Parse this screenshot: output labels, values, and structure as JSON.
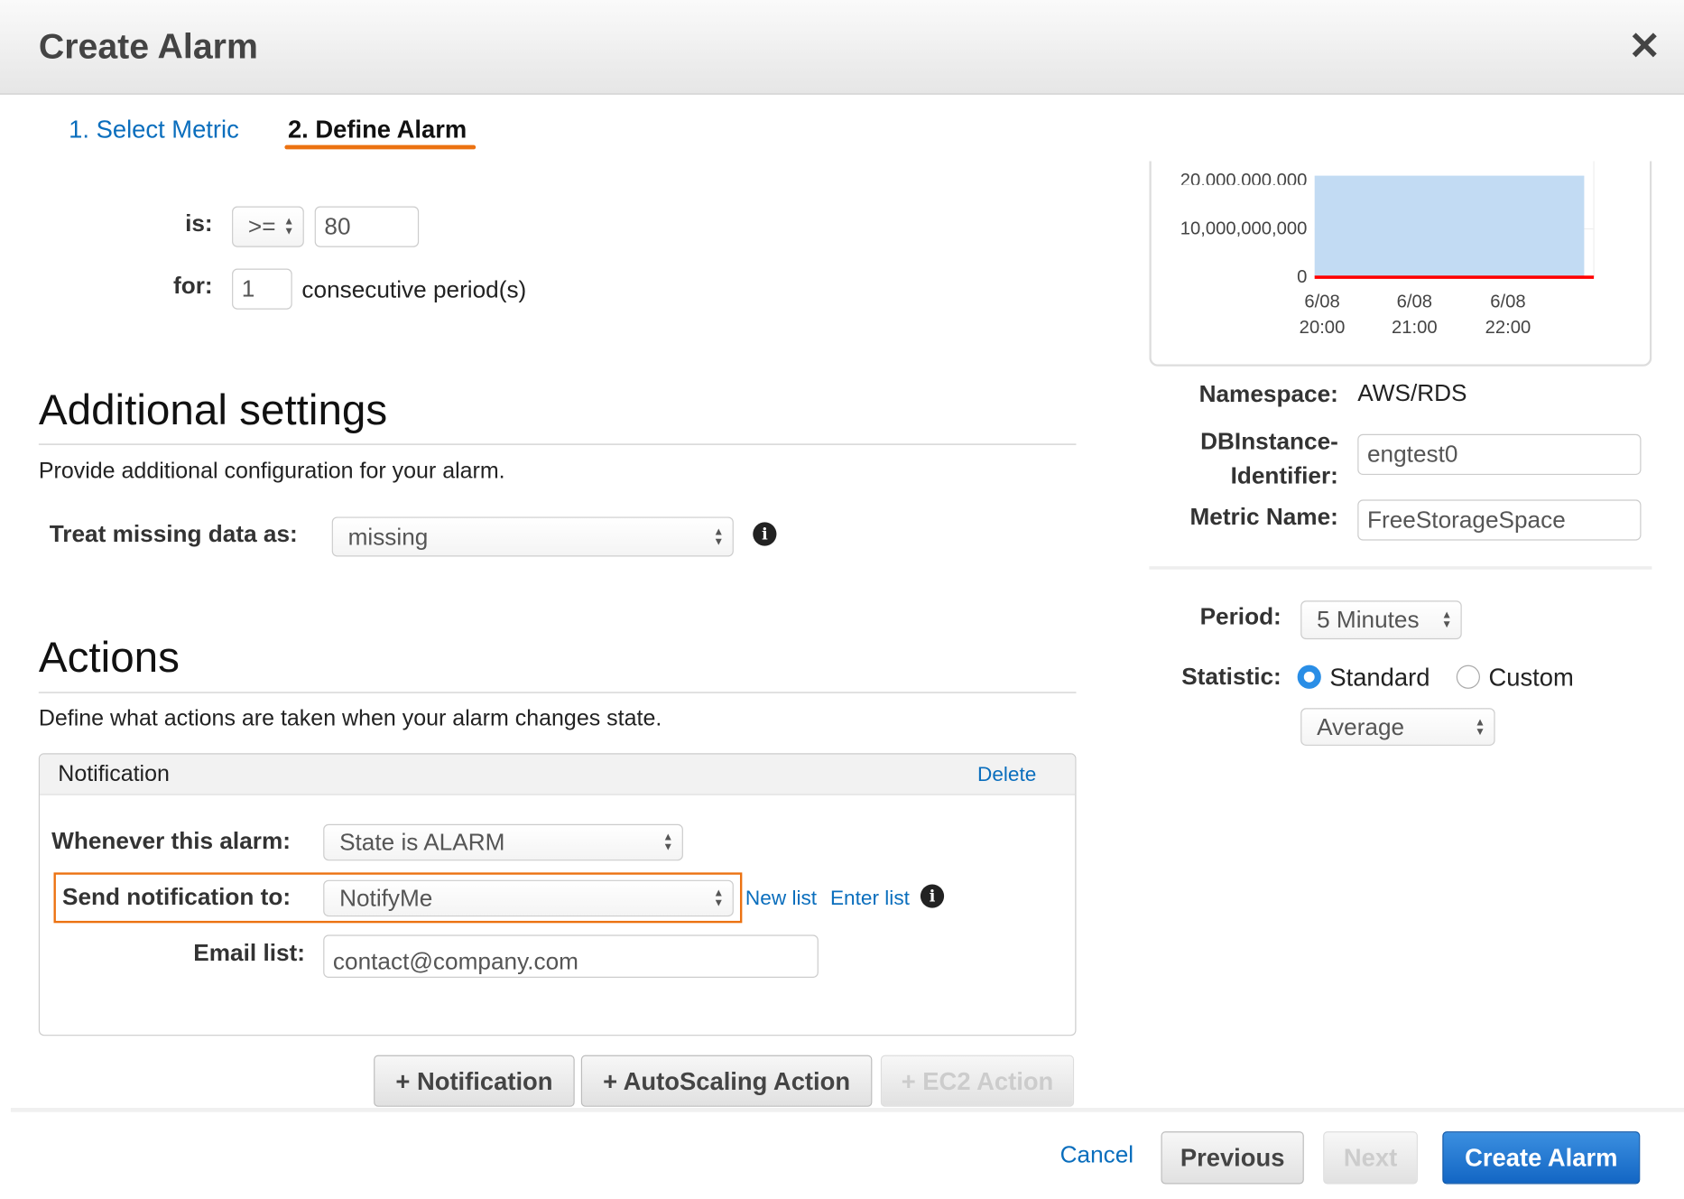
{
  "dialog": {
    "title": "Create Alarm",
    "close_icon": "close-icon"
  },
  "tabs": [
    {
      "label": "1. Select Metric",
      "active": false
    },
    {
      "label": "2. Define Alarm",
      "active": true
    }
  ],
  "threshold": {
    "is_label": "is:",
    "operator": ">=",
    "value": "80",
    "for_label": "for:",
    "periods": "1",
    "periods_suffix": "consecutive period(s)"
  },
  "additional": {
    "heading": "Additional settings",
    "description": "Provide additional configuration for your alarm.",
    "treat_label": "Treat missing data as:",
    "treat_value": "missing"
  },
  "actions": {
    "heading": "Actions",
    "description": "Define what actions are taken when your alarm changes state.",
    "notification": {
      "header": "Notification",
      "delete": "Delete",
      "whenever_label": "Whenever this alarm:",
      "whenever_value": "State is ALARM",
      "send_label": "Send notification to:",
      "send_value": "NotifyMe",
      "new_list": "New list",
      "enter_list": "Enter list",
      "email_label": "Email list:",
      "email_value": "contact@company.com"
    },
    "buttons": {
      "notification": "+ Notification",
      "autoscaling": "+ AutoScaling Action",
      "ec2": "+ EC2 Action"
    }
  },
  "footer": {
    "cancel": "Cancel",
    "previous": "Previous",
    "next": "Next",
    "create": "Create Alarm"
  },
  "metric": {
    "namespace_label": "Namespace:",
    "namespace_value": "AWS/RDS",
    "dbinstance_label_1": "DBInstance-",
    "dbinstance_label_2": "Identifier:",
    "dbinstance_value": "engtest0",
    "metric_name_label": "Metric Name:",
    "metric_name_value": "FreeStorageSpace"
  },
  "settings": {
    "period_label": "Period:",
    "period_value": "5 Minutes",
    "statistic_label": "Statistic:",
    "standard": "Standard",
    "custom": "Custom",
    "statistic_selected": "Standard",
    "aggregate_value": "Average"
  },
  "colors": {
    "accent": "#ec7211",
    "link": "#0a6ebd",
    "primary": "#1a6fc9",
    "area": "#c2dbf3",
    "threshold": "#ff0000"
  },
  "chart_data": {
    "type": "area",
    "x_ticks": [
      {
        "date": "6/08",
        "time": "20:00"
      },
      {
        "date": "6/08",
        "time": "21:00"
      },
      {
        "date": "6/08",
        "time": "22:00"
      }
    ],
    "y_ticks": [
      "20,000,000,000",
      "10,000,000,000",
      "0"
    ],
    "ylim": [
      0,
      21000000000
    ],
    "series": [
      {
        "x": [
          "6/08 19:55",
          "6/08 22:50"
        ],
        "values": [
          21000000000,
          21000000000
        ]
      }
    ],
    "threshold": 80
  }
}
